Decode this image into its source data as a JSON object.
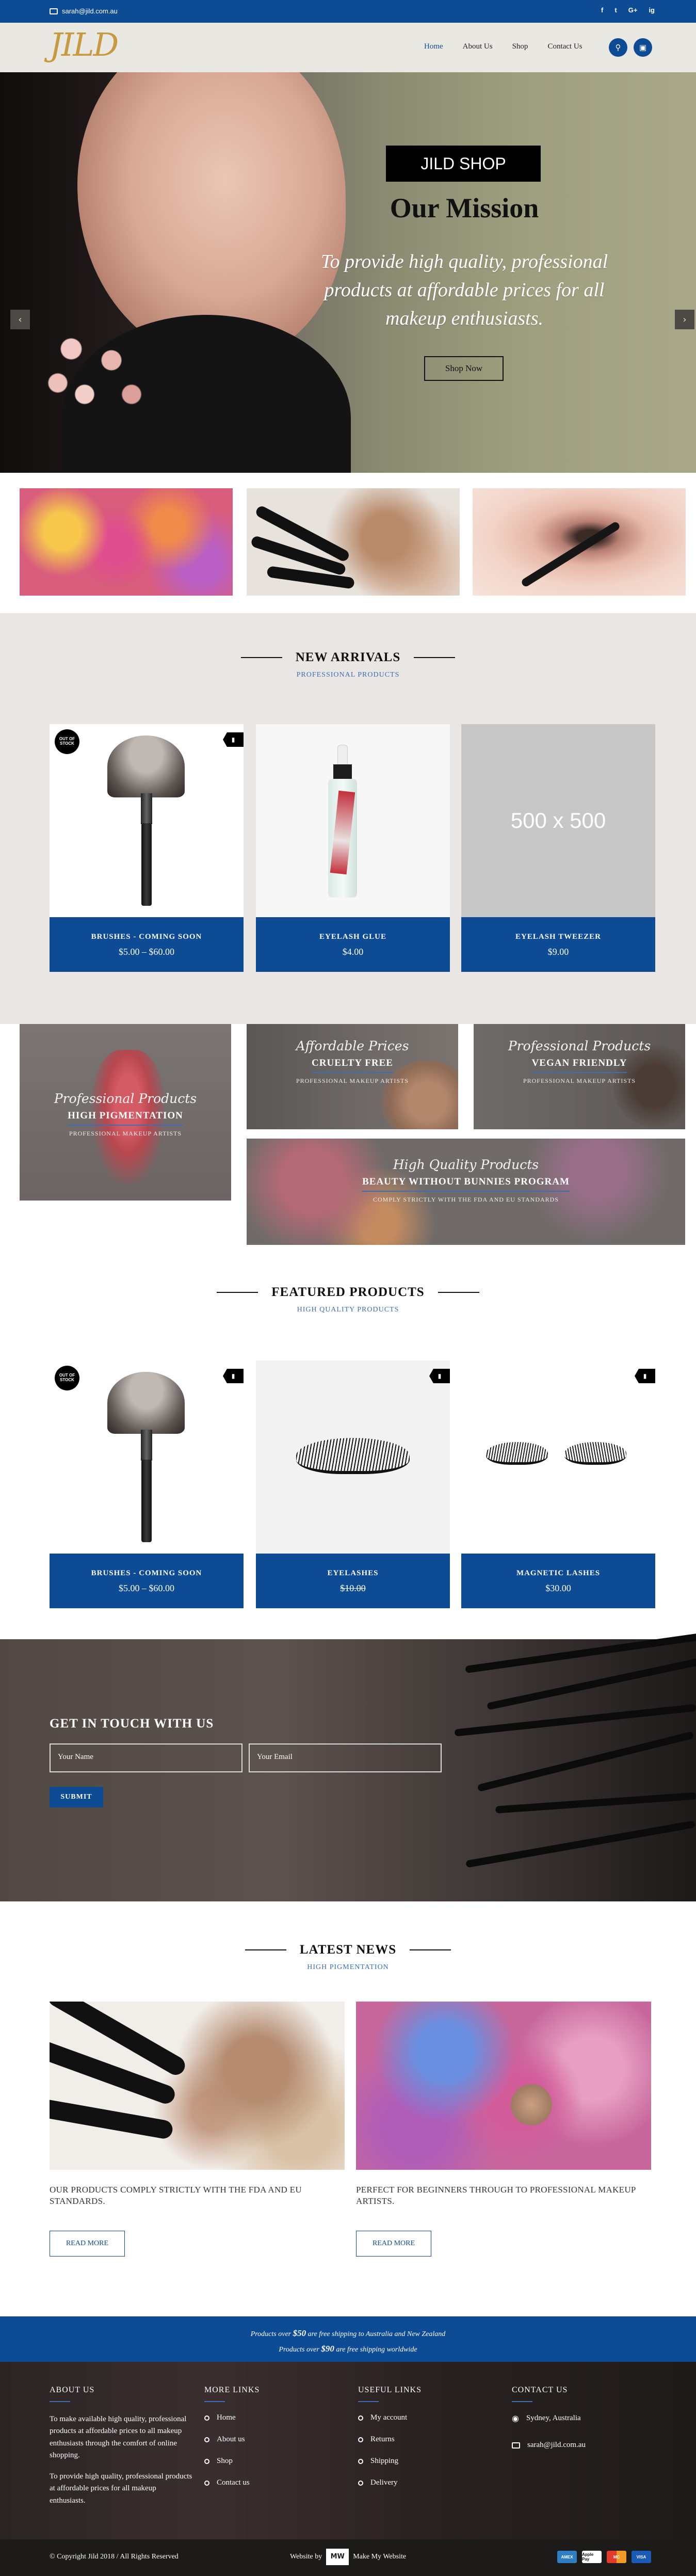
{
  "topbar": {
    "email": "sarah@jild.com.au",
    "social": [
      "f",
      "t",
      "G+",
      "ig"
    ]
  },
  "header": {
    "logo": "JILD",
    "menu": [
      "Home",
      "About Us",
      "Shop",
      "Contact Us"
    ],
    "active": "Home"
  },
  "hero": {
    "badge": "JILD SHOP",
    "heading": "Our Mission",
    "tagline": "To provide high quality, professional products at affordable prices for all makeup enthusiasts.",
    "button": "Shop Now"
  },
  "new_arrivals": {
    "title": "NEW ARRIVALS",
    "subtitle": "PROFESSIONAL PRODUCTS",
    "products": [
      {
        "name": "BRUSHES - COMING SOON",
        "price": "$5.00 – $60.00",
        "badge": "OUT OF STOCK"
      },
      {
        "name": "EYELASH GLUE",
        "price": "$4.00"
      },
      {
        "name": "EYELASH TWEEZER",
        "price": "$9.00",
        "placeholder": "500 x 500"
      }
    ]
  },
  "promos": [
    {
      "script": "Professional Products",
      "title": "HIGH PIGMENTATION",
      "sub": "PROFESSIONAL MAKEUP ARTISTS"
    },
    {
      "script": "Affordable Prices",
      "title": "CRUELTY FREE",
      "sub": "PROFESSIONAL MAKEUP ARTISTS"
    },
    {
      "script": "Professional Products",
      "title": "VEGAN FRIENDLY",
      "sub": "PROFESSIONAL MAKEUP ARTISTS"
    },
    {
      "script": "High Quality Products",
      "title": "BEAUTY WITHOUT BUNNIES PROGRAM",
      "sub": "COMPLY STRICTLY WITH THE FDA AND EU STANDARDS"
    }
  ],
  "featured": {
    "title": "FEATURED PRODUCTS",
    "subtitle": "HIGH QUALITY PRODUCTS",
    "products": [
      {
        "name": "BRUSHES - COMING SOON",
        "price": "$5.00 – $60.00",
        "badge": "OUT OF STOCK"
      },
      {
        "name": "EYELASHES",
        "price": "$10.00"
      },
      {
        "name": "MAGNETIC LASHES",
        "price": "$30.00"
      }
    ]
  },
  "contact": {
    "title": "GET IN TOUCH WITH US",
    "name_placeholder": "Your Name",
    "email_placeholder": "Your Email",
    "submit": "SUBMIT"
  },
  "news": {
    "title": "LATEST NEWS",
    "subtitle": "HIGH PIGMENTATION",
    "posts": [
      {
        "text": "OUR PRODUCTS COMPLY STRICTLY WITH THE FDA AND EU STANDARDS.",
        "button": "READ MORE"
      },
      {
        "text": "PERFECT FOR BEGINNERS THROUGH TO PROFESSIONAL MAKEUP ARTISTS.",
        "button": "READ MORE"
      }
    ]
  },
  "shipping": {
    "line1_pre": "Products over ",
    "line1_amt": "$50",
    "line1_post": " are free shipping to Australia and New Zealand",
    "line2_pre": "Products over ",
    "line2_amt": "$90",
    "line2_post": " are free shipping worldwide"
  },
  "footer": {
    "about_title": "ABOUT US",
    "about_p1": "To make available high quality, professional products at affordable prices to all makeup enthusiasts through the comfort of online shopping.",
    "about_p2": "To provide high quality, professional products at affordable prices for all makeup enthusiasts.",
    "more_title": "MORE LINKS",
    "more_links": [
      "Home",
      "About us",
      "Shop",
      "Contact us"
    ],
    "useful_title": "USEFUL LINKS",
    "useful_links": [
      "My account",
      "Returns",
      "Shipping",
      "Delivery"
    ],
    "contact_title": "CONTACT US",
    "location": "Sydney, Australia",
    "email": "sarah@jild.com.au",
    "copyright": "© Copyright Jild 2018 / All Rights Reserved",
    "website_by": "Website by",
    "make_my": "Make My Website",
    "payments": [
      "AMEX",
      "Apple Pay",
      "MC",
      "VISA"
    ]
  }
}
